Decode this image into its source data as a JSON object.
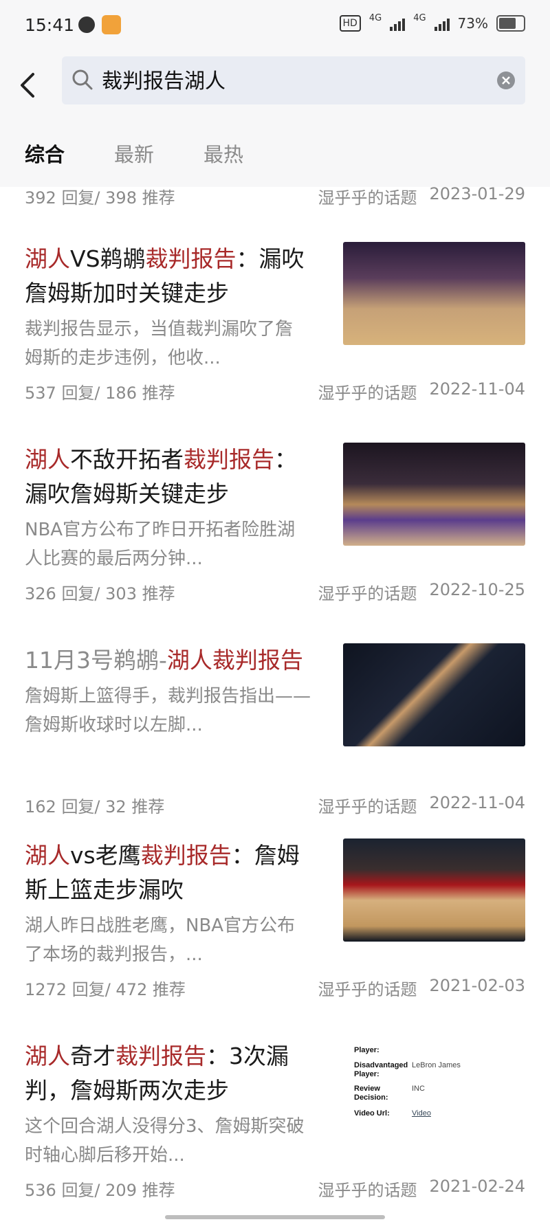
{
  "status": {
    "time": "15:41",
    "hd": "HD",
    "sim1": "4G",
    "sim2": "4G",
    "battery": "73%"
  },
  "search": {
    "query": "裁判报告湖人"
  },
  "tabs": [
    {
      "label": "综合",
      "active": true
    },
    {
      "label": "最新",
      "active": false
    },
    {
      "label": "最热",
      "active": false
    }
  ],
  "top_meta": {
    "stats": "392 回复/ 398 推荐",
    "source": "湿乎乎的话题",
    "date": "2023-01-29"
  },
  "posts": [
    {
      "title_parts": [
        {
          "text": "湖人",
          "hl": true
        },
        {
          "text": "VS鹈鹕",
          "hl": false
        },
        {
          "text": "裁判报告",
          "hl": true
        },
        {
          "text": "：漏吹",
          "hl": false
        },
        {
          "text": "詹姆斯加时关键走步",
          "hl": false
        }
      ],
      "snippet": [
        "裁判报告显示，当值裁判漏吹了詹",
        "姆斯的走步违例，他收..."
      ],
      "stats": "537 回复/ 186 推荐",
      "source": "湿乎乎的话题",
      "date": "2022-11-04",
      "thumb": "court"
    },
    {
      "title_parts": [
        {
          "text": "湖人",
          "hl": true
        },
        {
          "text": "不敌开拓者",
          "hl": false
        },
        {
          "text": "裁判报告",
          "hl": true
        },
        {
          "text": "：",
          "hl": false
        },
        {
          "text": "漏吹詹姆斯关键走步",
          "hl": false
        }
      ],
      "snippet": [
        "NBA官方公布了昨日开拓者险胜湖",
        "人比赛的最后两分钟..."
      ],
      "stats": "326 回复/ 303 推荐",
      "source": "湿乎乎的话题",
      "date": "2022-10-25",
      "thumb": "arena"
    },
    {
      "title_parts": [
        {
          "text": "11月3号鹈鹕-",
          "hl": false
        },
        {
          "text": "湖人裁判报告",
          "hl": true
        }
      ],
      "snippet": [
        "詹姆斯上篮得手，裁判报告指出——",
        "詹姆斯收球时以左脚..."
      ],
      "stats": "162 回复/ 32 推荐",
      "source": "湿乎乎的话题",
      "date": "2022-11-04",
      "thumb": "player"
    },
    {
      "title_parts": [
        {
          "text": "湖人",
          "hl": true
        },
        {
          "text": "vs老鹰",
          "hl": false
        },
        {
          "text": "裁判报告",
          "hl": true
        },
        {
          "text": "：詹姆",
          "hl": false
        },
        {
          "text": "斯上篮走步漏吹",
          "hl": false
        }
      ],
      "snippet": [
        "湖人昨日战胜老鹰，NBA官方公布",
        "了本场的裁判报告，..."
      ],
      "stats": "1272 回复/ 472 推荐",
      "source": "湿乎乎的话题",
      "date": "2021-02-03",
      "thumb": "hawks"
    },
    {
      "title_parts": [
        {
          "text": "湖人",
          "hl": true
        },
        {
          "text": "奇才",
          "hl": false
        },
        {
          "text": "裁判报告",
          "hl": true
        },
        {
          "text": "：3次漏",
          "hl": false
        },
        {
          "text": "判，詹姆斯两次走步",
          "hl": false
        }
      ],
      "snippet": [
        "这个回合湖人没得分3、詹姆斯突破",
        "时轴心脚后移开始..."
      ],
      "stats": "536 回复/ 209 推荐",
      "source": "湿乎乎的话题",
      "date": "2021-02-24",
      "thumb": "doc",
      "doc": {
        "player_label": "Player:",
        "disadvantaged_label": "Disadvantaged",
        "disadvantaged_label2": "Player:",
        "disadvantaged_value": "LeBron James",
        "review_label": "Review",
        "review_label2": "Decision:",
        "review_value": "INC",
        "video_label": "Video Url:",
        "video_value": "Video"
      }
    }
  ]
}
